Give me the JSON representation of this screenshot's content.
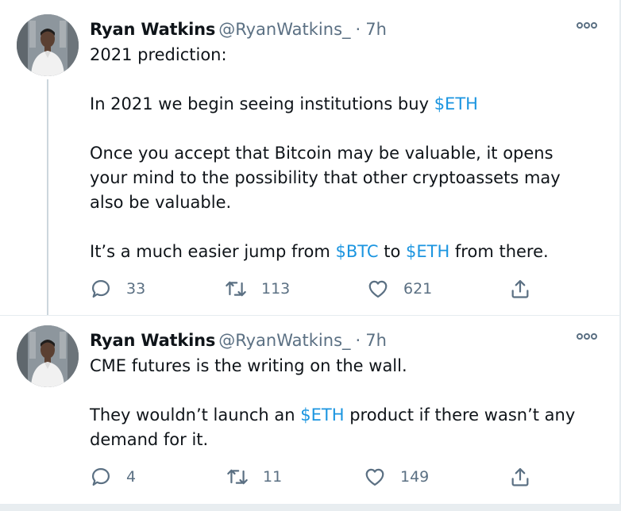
{
  "tweets": [
    {
      "author": {
        "name": "Ryan Watkins",
        "handle": "@RyanWatkins_"
      },
      "separator": "·",
      "time": "7h",
      "paragraphs": [
        [
          {
            "text": "2021 prediction:"
          }
        ],
        [
          {
            "text": "In 2021 we begin seeing institutions buy "
          },
          {
            "text": "$ETH",
            "link": true
          }
        ],
        [
          {
            "text": "Once you accept that Bitcoin may be valuable, it opens your mind to the possibility that other cryptoassets may also be valuable."
          }
        ],
        [
          {
            "text": "It’s a much easier jump from "
          },
          {
            "text": "$BTC",
            "link": true
          },
          {
            "text": " to "
          },
          {
            "text": "$ETH",
            "link": true
          },
          {
            "text": " from there."
          }
        ]
      ],
      "stats": {
        "replies": "33",
        "retweets": "113",
        "likes": "621"
      }
    },
    {
      "author": {
        "name": "Ryan Watkins",
        "handle": "@RyanWatkins_"
      },
      "separator": "·",
      "time": "7h",
      "paragraphs": [
        [
          {
            "text": "CME futures is the writing on the wall."
          }
        ],
        [
          {
            "text": "They wouldn’t launch an "
          },
          {
            "text": "$ETH",
            "link": true
          },
          {
            "text": " product if there wasn’t any demand for it."
          }
        ]
      ],
      "stats": {
        "replies": "4",
        "retweets": "11",
        "likes": "149"
      }
    }
  ],
  "icons": {
    "more": "more-horizontal-icon",
    "reply": "reply-icon",
    "retweet": "retweet-icon",
    "like": "heart-icon",
    "share": "share-icon"
  },
  "colors": {
    "text": "#0f1419",
    "secondary": "#5b7083",
    "link": "#1b95e0",
    "thread_line": "#ccd6dd",
    "divider": "#e6ecf0"
  }
}
